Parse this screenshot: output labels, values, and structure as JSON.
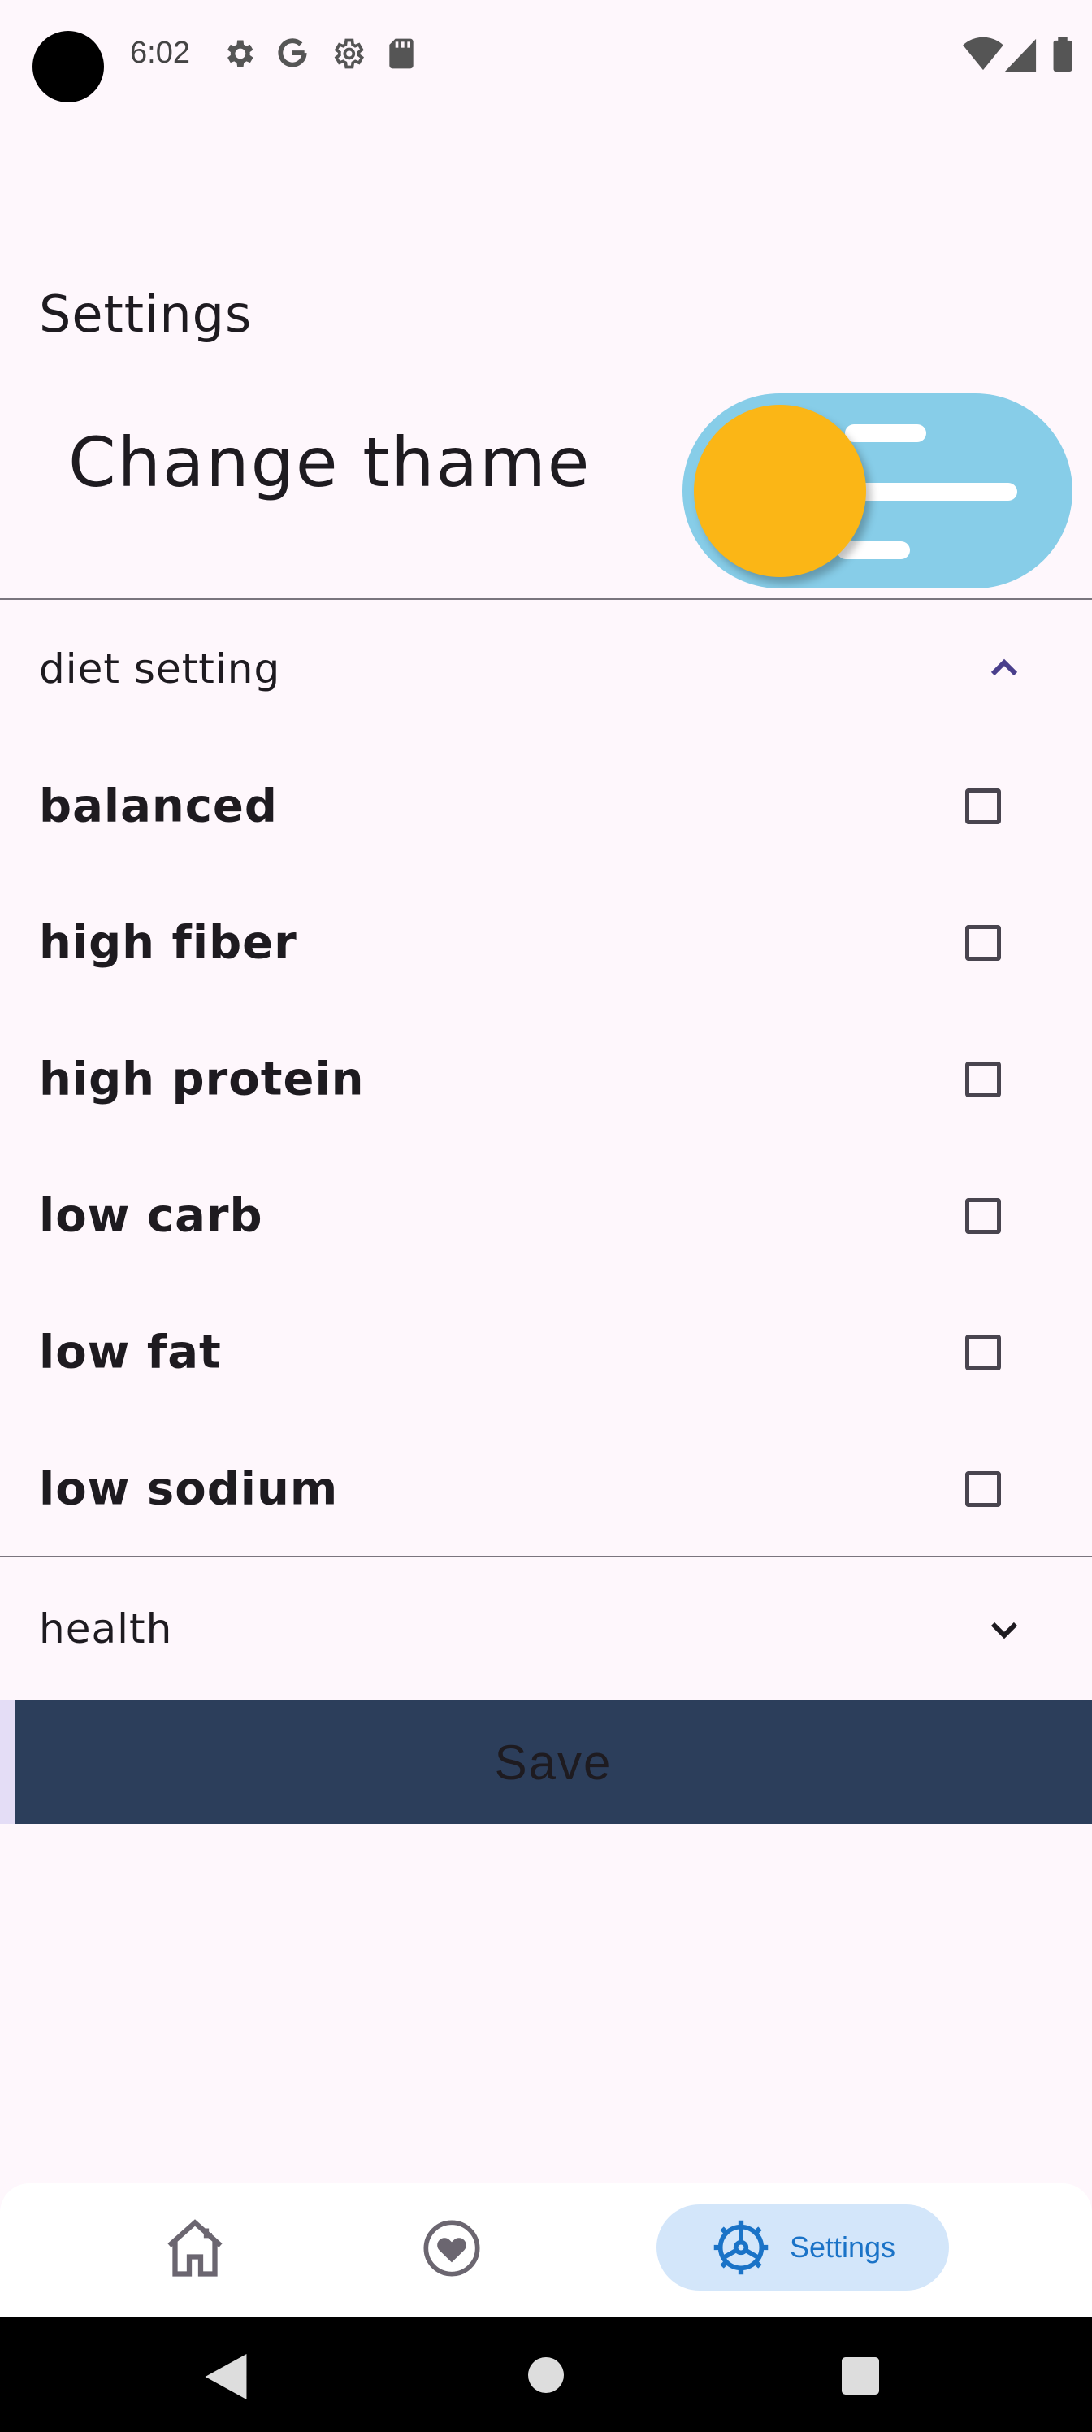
{
  "status_bar": {
    "time": "6:02",
    "icons_left": [
      "gear-icon",
      "google-icon",
      "gear-outline-icon",
      "sd-card-icon"
    ],
    "icons_right": [
      "wifi-icon",
      "signal-icon",
      "battery-icon"
    ]
  },
  "page": {
    "title": "Settings"
  },
  "theme": {
    "label": "Change thame",
    "toggle_state": "light",
    "colors": {
      "track": "#87CDE8",
      "knob": "#FBB616"
    }
  },
  "diet_section": {
    "label": "diet setting",
    "expanded": true,
    "options": [
      {
        "label": "balanced",
        "checked": false
      },
      {
        "label": "high fiber",
        "checked": false
      },
      {
        "label": "high protein",
        "checked": false
      },
      {
        "label": "low carb",
        "checked": false
      },
      {
        "label": "low fat",
        "checked": false
      },
      {
        "label": "low sodium",
        "checked": false
      }
    ]
  },
  "health_section": {
    "label": "health",
    "expanded": false
  },
  "save": {
    "label": "Save",
    "color": "#2C3E5B"
  },
  "bottom_nav": {
    "items": [
      {
        "icon": "home-icon",
        "label": ""
      },
      {
        "icon": "heart-icon",
        "label": ""
      },
      {
        "icon": "settings-icon",
        "label": "Settings",
        "active": true
      }
    ],
    "accent": "#1A73C7"
  },
  "system_nav": {
    "buttons": [
      "back-icon",
      "home-circle-icon",
      "recents-icon"
    ]
  }
}
